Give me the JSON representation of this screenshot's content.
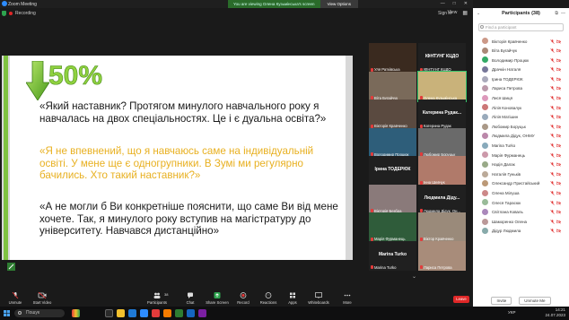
{
  "window": {
    "app_title": "Zoom Meeting",
    "controls": [
      "—",
      "□",
      "✕"
    ]
  },
  "banner": {
    "message": "You are viewing Олена Кузьмінська's screen",
    "view_options": "View Options"
  },
  "topbar": {
    "recording_label": "Recording",
    "sign_in": "Sign in",
    "view_label": "View"
  },
  "slide": {
    "percent": "50%",
    "para1": "«Який наставник? Протягом минулого навчального року я навчалась на двох спеціальностях. Це і є дуальна освіта?»",
    "para2": "«Я не впевнений, що я навчаюсь саме на індивідуальній освіті. У мене ще є одногрупники. В Зумі ми регулярно бачились. Хто такий наставник?»",
    "para3": "«А не могли б Ви конкретніше пояснити, що саме Ви від мене хочете. Так, я минулого року вступив на магістратуру до університету. Навчався дистанційно»",
    "colors": {
      "highlight": "#e8b020",
      "accent_green": "#8fd13f"
    }
  },
  "gallery": {
    "tiles": [
      {
        "name": "Уля Ратківська",
        "big": ""
      },
      {
        "name": "ІФНТУНГ КЦДО",
        "big": "ІФНТУНГ КЦДО"
      },
      {
        "name": "Віта Бугайчук",
        "big": ""
      },
      {
        "name": "Олена Кузьмінська",
        "big": ""
      },
      {
        "name": "Вікторія Кравченко",
        "big": ""
      },
      {
        "name": "Катерина Рудак",
        "big": "Катерина Рудак..."
      },
      {
        "name": "Володимир Процюк",
        "big": ""
      },
      {
        "name": "Любомир Боруцьк",
        "big": ""
      },
      {
        "name": "",
        "big": "Ірина ТОДЕРЮК"
      },
      {
        "name": "Інна Шевчук",
        "big": ""
      },
      {
        "name": "Вікторія Безбра",
        "big": ""
      },
      {
        "name": "Людмила Дідук, Он...",
        "big": "Людмила Діду..."
      },
      {
        "name": "Марія Фурманець",
        "big": ""
      },
      {
        "name": "Віктор Кравченко",
        "big": ""
      },
      {
        "name": "Marina Turko",
        "big": "Marina Turko"
      },
      {
        "name": "Лариса Петрова",
        "big": ""
      }
    ],
    "page_label": "1/2"
  },
  "participants": {
    "title": "Participants (38)",
    "search_placeholder": "Find a participant",
    "list": [
      "Вікторія Кравченко",
      "Віта Бугайчук",
      "Володимир Процюк",
      "Драчкін Наталя",
      "Ірина ТОДЕРЮК",
      "Лариса Петрова",
      "Лися Шиця",
      "Лілія Коновалук",
      "Лілія Матішин",
      "Любомир Боруцьк",
      "Людмила Дідук, ОНМУ",
      "Marina Turko",
      "Марія Фурманець",
      "Надія Далак",
      "Наталія Гуньків",
      "Олександр Пристайський",
      "Олена Мілуша",
      "Олеся Тарасюк",
      "Світлана Коваль",
      "Шаморенко Олена",
      "Дідур Людмила"
    ],
    "invite": "Invite",
    "unmute_me": "Unmute Me"
  },
  "toolbar": {
    "items": [
      "Unmute",
      "Start Video",
      "Participants",
      "Chat",
      "Share Screen",
      "Record",
      "Reactions",
      "Apps",
      "Whiteboards",
      "More"
    ],
    "participants_count": "38",
    "end": "Leave"
  },
  "taskbar": {
    "search": "Пошук",
    "lang": "УКР",
    "time": "14:21",
    "date": "24.07.2023"
  }
}
